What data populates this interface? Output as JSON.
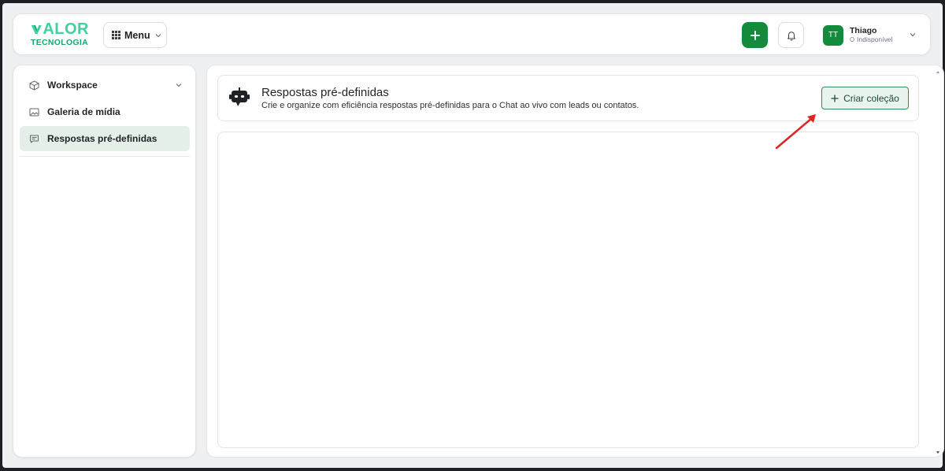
{
  "brand": {
    "logo_top": "VALOR",
    "logo_rest": "ALOR",
    "logo_bottom": "TECNOLOGIA",
    "colors": {
      "primary": "#138a3c",
      "logo_light": "#3ed2a0",
      "logo_dark": "#16a86a"
    }
  },
  "header": {
    "menu_label": "Menu",
    "menu_icon": "grid-icon",
    "add_icon": "plus-icon",
    "notifications_icon": "bell-icon",
    "user": {
      "initials": "TT",
      "name": "Thiago",
      "status": "Indisponível"
    }
  },
  "sidebar": {
    "items": [
      {
        "label": "Workspace",
        "icon": "cube-icon",
        "expandable": true
      },
      {
        "label": "Galeria de mídia",
        "icon": "image-icon"
      },
      {
        "label": "Respostas pré-definidas",
        "icon": "message-icon",
        "active": true
      }
    ]
  },
  "page": {
    "icon": "bot-icon",
    "title": "Respostas pré-definidas",
    "subtitle": "Crie e organize com eficiência respostas pré-definidas para o Chat ao vivo com leads ou contatos.",
    "create_button": "Criar coleção"
  },
  "annotation": {
    "arrow_color": "#e02424"
  }
}
